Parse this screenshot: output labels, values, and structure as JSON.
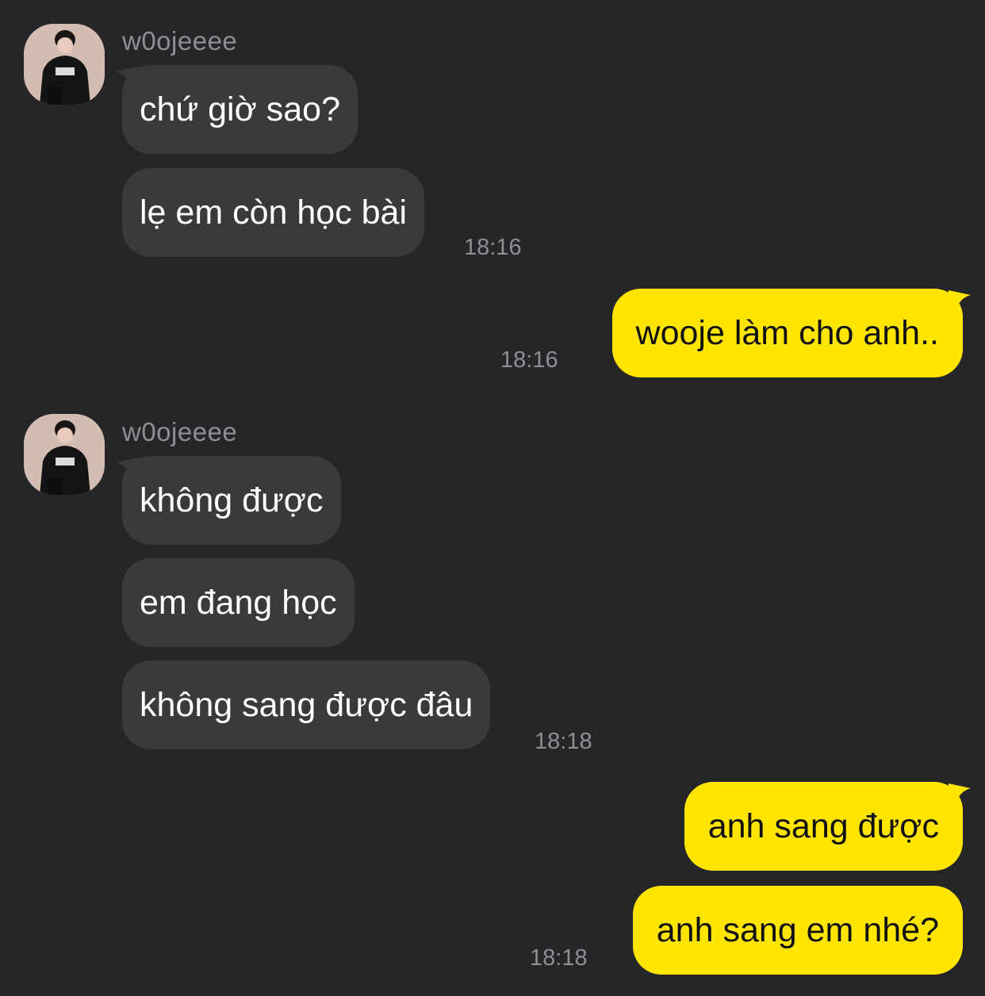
{
  "colors": {
    "background": "#262628",
    "incoming_bubble": "#3a3a3c",
    "outgoing_bubble": "#ffe500",
    "meta_text": "#8e8e93"
  },
  "icons": {
    "avatar": "profile-photo-icon"
  },
  "messages": {
    "group1": {
      "sender": "w0ojeeee",
      "m1": "chứ giờ sao?",
      "m2": "lẹ em còn học bài",
      "time": "18:16"
    },
    "group2": {
      "m1": "wooje làm cho anh..",
      "time": "18:16"
    },
    "group3": {
      "sender": "w0ojeeee",
      "m1": "không được",
      "m2": "em đang học",
      "m3": "không sang được đâu",
      "time": "18:18"
    },
    "group4": {
      "m1": "anh sang được",
      "m2": "anh sang em nhé?",
      "time": "18:18"
    }
  }
}
